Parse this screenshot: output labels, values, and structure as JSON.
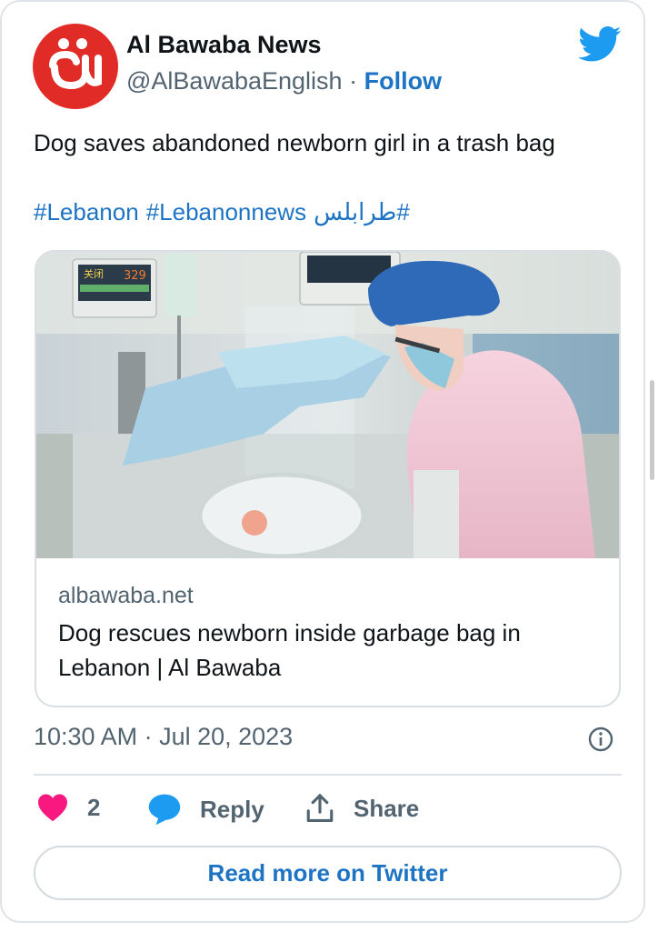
{
  "author": {
    "name": "Al Bawaba News",
    "handle": "@AlBawabaEnglish",
    "separator": "·",
    "follow_label": "Follow"
  },
  "tweet": {
    "text": "Dog saves abandoned newborn girl in a trash bag",
    "hashtags": [
      "#Lebanon",
      "#Lebanonnews",
      "#طرابلس"
    ]
  },
  "link_card": {
    "domain": "albawaba.net",
    "title": "Dog rescues newborn inside garbage bag in Lebanon | Al Bawaba",
    "image_monitor_text": "329",
    "image_monitor_label": "关闭"
  },
  "meta": {
    "timestamp": "10:30 AM · Jul 20, 2023"
  },
  "actions": {
    "like_count": "2",
    "reply_label": "Reply",
    "share_label": "Share"
  },
  "read_more_label": "Read more on Twitter",
  "icons": {
    "avatar": "albawaba-logo",
    "brand": "twitter-bird-icon",
    "info": "info-icon",
    "like": "heart-icon",
    "reply": "speech-bubble-icon",
    "share": "share-upload-icon"
  },
  "colors": {
    "link_blue": "#1d74c4",
    "twitter_blue": "#1d9bf0",
    "heart_pink": "#f91880",
    "avatar_red": "#e02b27",
    "secondary_text": "#536471"
  }
}
